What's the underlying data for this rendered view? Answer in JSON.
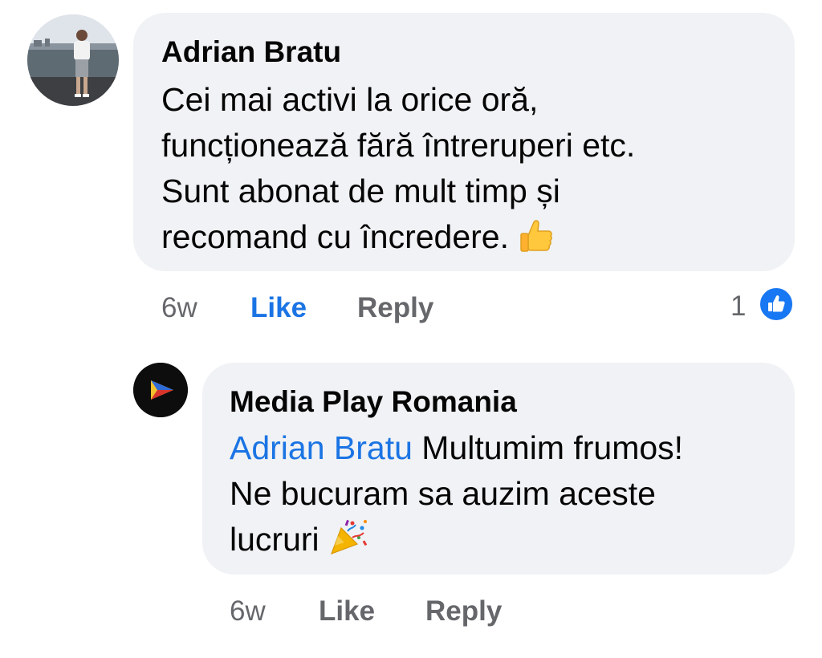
{
  "comments": [
    {
      "author": "Adrian Bratu",
      "text_lines": [
        "Cei mai activi la orice oră,",
        "funcționează fără întreruperi etc.",
        "Sunt abonat de mult timp și",
        "recomand cu încredere."
      ],
      "emoji": "thumbs-up-icon",
      "time": "6w",
      "like_label": "Like",
      "reply_label": "Reply",
      "reaction_count": "1",
      "like_label_color": "#1b74e4"
    }
  ],
  "replies": [
    {
      "author": "Media Play Romania",
      "mention": "Adrian Bratu",
      "text_lines": [
        " Multumim frumos!",
        "Ne bucuram sa auzim aceste",
        "lucruri"
      ],
      "emoji": "party-popper-icon",
      "time": "6w",
      "like_label": "Like",
      "reply_label": "Reply"
    }
  ],
  "colors": {
    "bubble": "#f0f2f5",
    "link_blue": "#1b74e4",
    "meta_gray": "#65676b",
    "reaction_blue": "#1877f2"
  }
}
